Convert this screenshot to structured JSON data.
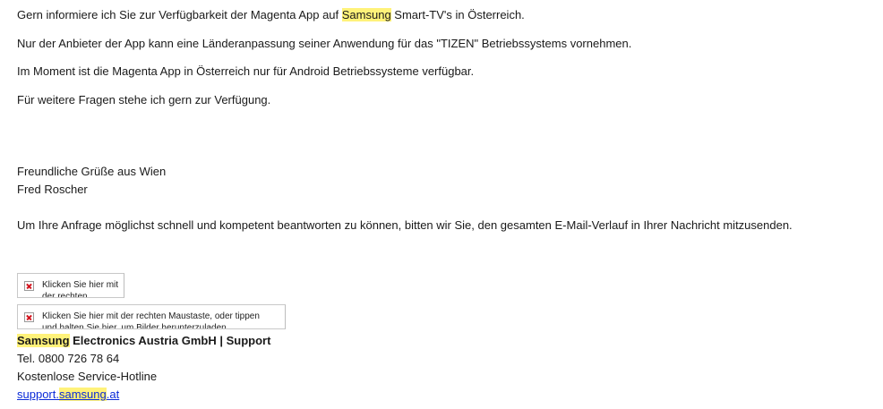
{
  "email": {
    "para1": {
      "before": "Gern informiere ich Sie zur Verfügbarkeit der Magenta App auf ",
      "highlight": "Samsung",
      "after": " Smart-TV's in Österreich."
    },
    "para2": "Nur der Anbieter der App kann eine Länderanpassung seiner Anwendung für das \"TIZEN\" Betriebssystems vornehmen.",
    "para3": "Im Moment ist die Magenta App in Österreich nur für Android Betriebssysteme verfügbar.",
    "para4": "Für weitere Fragen stehe ich gern zur Verfügung.",
    "greeting": "Freundliche Grüße aus Wien",
    "sender": "Fred Roscher",
    "notice": "Um Ihre Anfrage möglichst schnell und kompetent beantworten zu können, bitten wir Sie, den gesamten E-Mail-Verlauf in Ihrer Nachricht mitzusenden."
  },
  "images": {
    "img1_alt": "Klicken Sie hier mit der rechten Maustaste, oder tippen und halten Sie hier",
    "img2_alt": "Klicken Sie hier mit der rechten Maustaste, oder tippen und halten Sie hier, um Bilder herunterzuladen"
  },
  "signature": {
    "company_highlight": "Samsung",
    "company_rest": " Electronics Austria GmbH | Support",
    "phone": "Tel. 0800 726 78 64",
    "hotline": "Kostenlose Service-Hotline",
    "link_prefix": "support.",
    "link_highlight": "samsung",
    "link_suffix": ".at"
  },
  "colors": {
    "highlight": "#fff27a",
    "link": "#0b2bd8"
  }
}
